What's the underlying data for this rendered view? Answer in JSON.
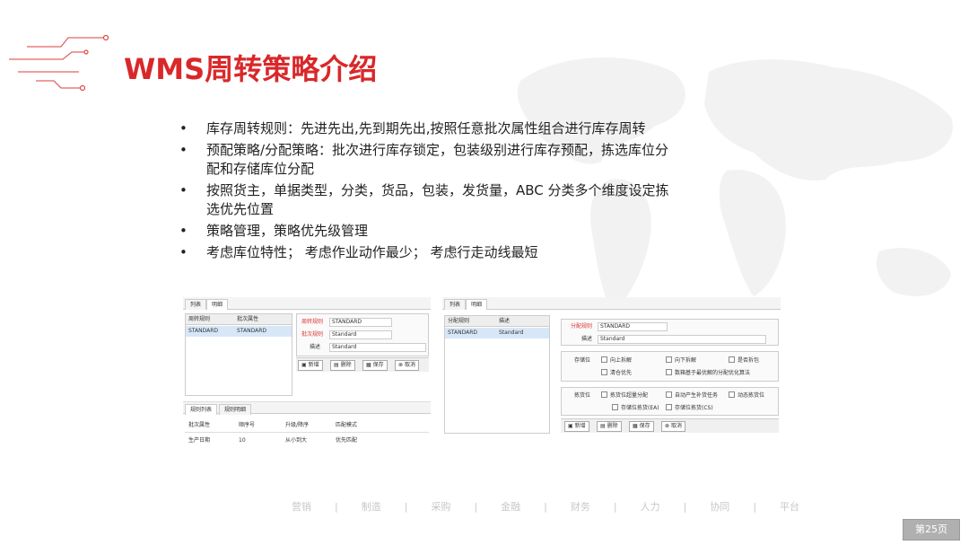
{
  "title": "WMS周转策略介绍",
  "bullets": [
    "库存周转规则：先进先出,先到期先出,按照任意批次属性组合进行库存周转",
    "预配策略/分配策略：批次进行库存锁定，包装级别进行库存预配，拣选库位分配和存储库位分配",
    "按照货主，单据类型，分类，货品，包装，发货量，ABC 分类多个维度设定拣选优先位置",
    "策略管理，策略优先级管理",
    "考虑库位特性； 考虑作业动作最少； 考虑行走动线最短"
  ],
  "shot1": {
    "tabs": [
      "列表",
      "明细"
    ],
    "grid_headers": [
      "周转规则",
      "批次属性"
    ],
    "grid_row": [
      "STANDARD",
      "STANDARD"
    ],
    "form_labels": [
      "周转规则",
      "批次规则",
      "描述"
    ],
    "form_values": [
      "STANDARD",
      "Standard",
      "Standard"
    ],
    "buttons": [
      "新增",
      "删除",
      "保存",
      "取消"
    ],
    "subtabs": [
      "规则列表",
      "规则明细"
    ],
    "sub_headers": [
      "批次属性",
      "顺序号",
      "升级/降序",
      "匹配模式"
    ],
    "sub_row": [
      "生产日期",
      "10",
      "从小到大",
      "优先匹配"
    ]
  },
  "shot2": {
    "tabs": [
      "列表",
      "明细"
    ],
    "grid_headers": [
      "分配规则",
      "描述"
    ],
    "grid_row": [
      "STANDARD",
      "Standard"
    ],
    "form_labels": [
      "分配规则",
      "描述"
    ],
    "form_values": [
      "STANDARD",
      "Standard"
    ],
    "storage_label": "存储位",
    "storage_options": [
      "向上拆解",
      "向下拆解",
      "是否拆包",
      "清仓优先",
      "数箱基于最优解的分配优化算法"
    ],
    "pick_label": "拣货位",
    "pick_options": [
      "拣货位超量分配",
      "自动产生补货任务",
      "动态拣货位",
      "存储位拣货(EA)",
      "存储位拣货(CS)"
    ],
    "buttons": [
      "新增",
      "删除",
      "保存",
      "取消"
    ]
  },
  "footer": [
    "营销",
    "|",
    "制造",
    "|",
    "采购",
    "|",
    "金融",
    "|",
    "财务",
    "|",
    "人力",
    "|",
    "协同",
    "|",
    "平台"
  ],
  "page_label": "第25页",
  "colors": {
    "title": "#d9282a",
    "accent_line": "#e04848"
  }
}
